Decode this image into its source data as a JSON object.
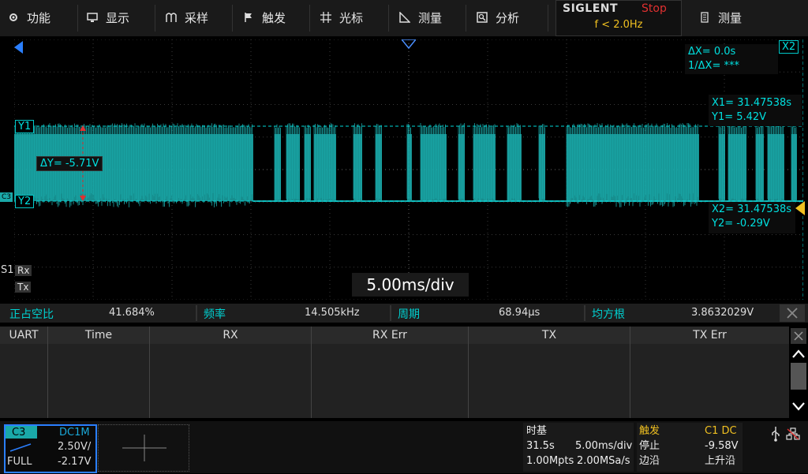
{
  "menu": {
    "items": [
      {
        "label": "功能",
        "icon": "gear-icon"
      },
      {
        "label": "显示",
        "icon": "monitor-icon"
      },
      {
        "label": "采样",
        "icon": "sample-icon"
      },
      {
        "label": "触发",
        "icon": "flag-icon"
      },
      {
        "label": "光标",
        "icon": "cursor-cross-icon"
      },
      {
        "label": "测量",
        "icon": "ruler-icon"
      },
      {
        "label": "分析",
        "icon": "analyze-icon"
      }
    ],
    "right_label": "测量",
    "right_icon": "document-icon"
  },
  "brand": {
    "logo": "SIGLENT",
    "status": "Stop",
    "trigger_freq": "f < 2.0Hz"
  },
  "cursors": {
    "delta_x": "ΔX= 0.0s",
    "inv_delta_x": "1/ΔX= ***",
    "x1": "X1= 31.47538s",
    "y1": "Y1= 5.42V",
    "x2": "X2= 31.47538s",
    "y2": "Y2= -0.29V",
    "delta_y": "ΔY= -5.71V",
    "label_x2": "X2",
    "label_y1": "Y1",
    "label_y2": "Y2"
  },
  "channel_marker": "C3",
  "serial_labels": {
    "s1": "S1",
    "rx": "Rx",
    "tx": "Tx"
  },
  "timebase_overlay": "5.00ms/div",
  "measurements": [
    {
      "label": "正占空比",
      "value": "41.684%"
    },
    {
      "label": "频率",
      "value": "14.505kHz"
    },
    {
      "label": "周期",
      "value": "68.94µs"
    },
    {
      "label": "均方根",
      "value": "3.8632029V"
    }
  ],
  "table": {
    "headers": [
      "UART",
      "Time",
      "RX",
      "RX Err",
      "TX",
      "TX Err"
    ]
  },
  "channel": {
    "name": "C3",
    "coupling": "DC1M",
    "scale": "2.50V/",
    "bw": "FULL",
    "offset": "-2.17V"
  },
  "timebase": {
    "label": "时基",
    "time": "31.5s",
    "per_div": "5.00ms/div",
    "points": "1.00Mpts",
    "rate": "2.00MSa/s"
  },
  "trigger": {
    "label": "触发",
    "source": "C1 DC",
    "mode": "停止",
    "level": "-9.58V",
    "type": "边沿",
    "slope": "上升沿"
  },
  "colors": {
    "trace": "#1aa8a8",
    "cursor": "#00e0e0",
    "accent": "#f0c020",
    "stop": "#e03030"
  }
}
